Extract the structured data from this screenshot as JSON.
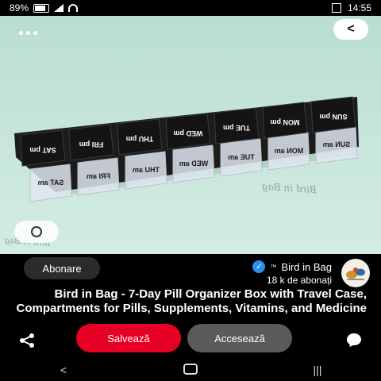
{
  "status": {
    "time": "14:55",
    "battery": "89%"
  },
  "hero": {
    "back_label": "<",
    "lens_label": "",
    "watermark": "Bird in Bag",
    "pill_box": {
      "lids": [
        "SUN pm",
        "MON pm",
        "TUE pm",
        "WED pm",
        "THU pm",
        "FRI pm",
        "SAT pm"
      ],
      "cups": [
        "SUN am",
        "MON am",
        "TUE am",
        "WED am",
        "THU am",
        "FRI am",
        "SAT am"
      ]
    }
  },
  "pin": {
    "board_name": "Bird in Bag",
    "trademark": "™",
    "followers": "18 k de abonați",
    "follow_label": "Abonare",
    "title": "Bird in Bag - 7-Day Pill Organizer Box with Travel Case, Compartments for Pills, Supplements, Vitamins, and Medicine"
  },
  "actions": {
    "visit_label": "Accesează",
    "save_label": "Salvează"
  },
  "colors": {
    "save": "#e60023",
    "verified": "#2f8df0",
    "background_photo": "#c8e6dc"
  },
  "icons": {
    "share": "share-icon",
    "comment": "comment-icon",
    "more": "more-icon",
    "back": "back-arrow-icon",
    "lens": "lens-icon",
    "verified": "verified-icon"
  }
}
